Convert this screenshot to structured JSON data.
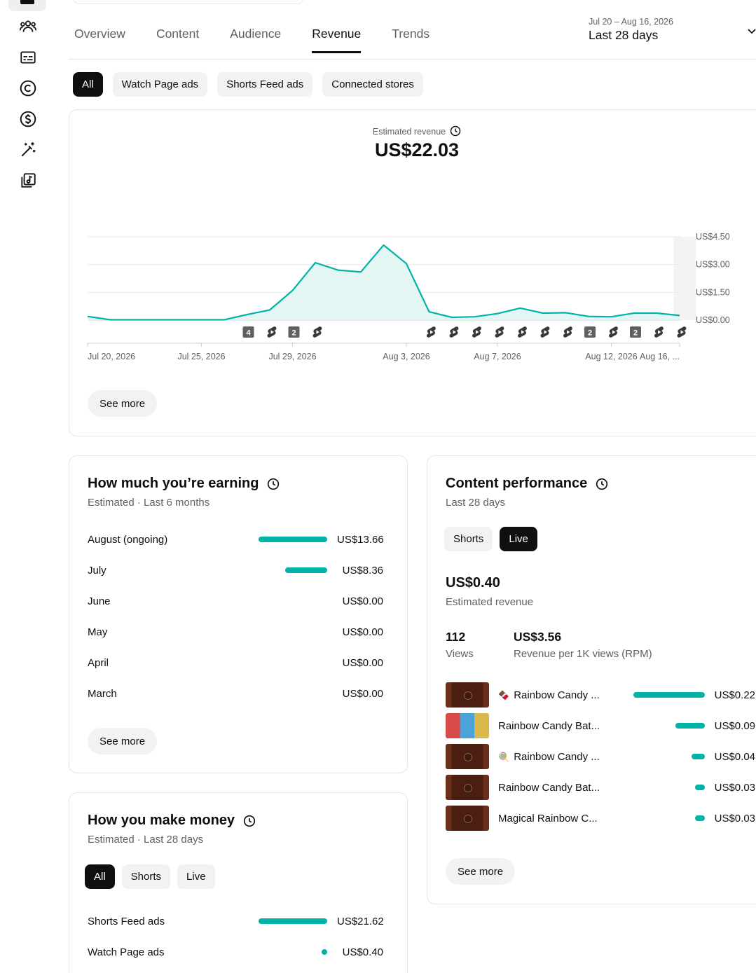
{
  "tabs": [
    "Overview",
    "Content",
    "Audience",
    "Revenue",
    "Trends"
  ],
  "active_tab": "Revenue",
  "date_range": {
    "dates": "Jul 20 – Aug 16, 2026",
    "label": "Last 28 days"
  },
  "chips": [
    "All",
    "Watch Page ads",
    "Shorts Feed ads",
    "Connected stores"
  ],
  "main": {
    "label": "Estimated revenue",
    "value": "US$22.03",
    "see_more": "See more"
  },
  "chart_data": {
    "type": "area",
    "ylim": [
      0,
      4.5
    ],
    "yticks": [
      "US$0.00",
      "US$1.50",
      "US$3.00",
      "US$4.50"
    ],
    "xtick_labels": [
      "Jul 20, 2026",
      "Jul 25, 2026",
      "Jul 29, 2026",
      "Aug 3, 2026",
      "Aug 7, 2026",
      "Aug 12, 2026",
      "Aug 16, ..."
    ],
    "xtick_index": [
      0,
      5,
      9,
      14,
      18,
      23,
      26
    ],
    "values": [
      0.2,
      0.02,
      0.02,
      0.02,
      0.02,
      0.02,
      0.02,
      0.3,
      0.55,
      1.6,
      3.1,
      2.7,
      2.6,
      4.05,
      3.05,
      0.45,
      0.15,
      0.18,
      0.35,
      0.65,
      0.38,
      0.4,
      0.2,
      0.18,
      0.38,
      0.38,
      0.25
    ],
    "markers": [
      {
        "day": 7,
        "kind": "badge",
        "text": "4"
      },
      {
        "day": 8,
        "kind": "shorts"
      },
      {
        "day": 9,
        "kind": "badge",
        "text": "2"
      },
      {
        "day": 10,
        "kind": "shorts"
      },
      {
        "day": 15,
        "kind": "shorts"
      },
      {
        "day": 16,
        "kind": "shorts"
      },
      {
        "day": 17,
        "kind": "shorts"
      },
      {
        "day": 18,
        "kind": "shorts"
      },
      {
        "day": 19,
        "kind": "shorts"
      },
      {
        "day": 20,
        "kind": "shorts"
      },
      {
        "day": 21,
        "kind": "shorts"
      },
      {
        "day": 22,
        "kind": "badge",
        "text": "2"
      },
      {
        "day": 23,
        "kind": "shorts"
      },
      {
        "day": 24,
        "kind": "badge",
        "text": "2"
      },
      {
        "day": 25,
        "kind": "shorts"
      },
      {
        "day": 26,
        "kind": "shorts"
      }
    ]
  },
  "earning": {
    "title": "How much you’re earning",
    "subtitle": "Estimated · Last 6 months",
    "see_more": "See more",
    "rows": [
      {
        "label": "August (ongoing)",
        "value": "US$13.66",
        "amount": 13.66
      },
      {
        "label": "July",
        "value": "US$8.36",
        "amount": 8.36
      },
      {
        "label": "June",
        "value": "US$0.00",
        "amount": 0
      },
      {
        "label": "May",
        "value": "US$0.00",
        "amount": 0
      },
      {
        "label": "April",
        "value": "US$0.00",
        "amount": 0
      },
      {
        "label": "March",
        "value": "US$0.00",
        "amount": 0
      }
    ]
  },
  "money": {
    "title": "How you make money",
    "subtitle": "Estimated · Last 28 days",
    "chips": [
      "All",
      "Shorts",
      "Live"
    ],
    "rows": [
      {
        "label": "Shorts Feed ads",
        "value": "US$21.62",
        "amount": 21.62
      },
      {
        "label": "Watch Page ads",
        "value": "US$0.40",
        "amount": 0.4
      }
    ]
  },
  "content": {
    "title": "Content performance",
    "subtitle": "Last 28 days",
    "chips": [
      "Shorts",
      "Live"
    ],
    "revenue_value": "US$0.40",
    "revenue_label": "Estimated revenue",
    "views_value": "112",
    "views_label": "Views",
    "rpm_value": "US$3.56",
    "rpm_label": "Revenue per 1K views (RPM)",
    "see_more": "See more",
    "videos": [
      {
        "title": "Rainbow Candy ...",
        "emoji": "🍫",
        "value": "US$0.22",
        "amount": 0.22,
        "thumb": "brown"
      },
      {
        "title": "Rainbow Candy Bat...",
        "emoji": "",
        "value": "US$0.09",
        "amount": 0.09,
        "thumb": "multi"
      },
      {
        "title": "Rainbow Candy ...",
        "emoji": "🍭",
        "value": "US$0.04",
        "amount": 0.04,
        "thumb": "brown"
      },
      {
        "title": "Rainbow Candy Bat...",
        "emoji": "",
        "value": "US$0.03",
        "amount": 0.03,
        "thumb": "brown"
      },
      {
        "title": "Magical Rainbow C...",
        "emoji": "",
        "value": "US$0.03",
        "amount": 0.03,
        "thumb": "brown"
      }
    ]
  },
  "colors": {
    "accent": "#00b3a6",
    "area_fill": "#e3f6f4",
    "text": "#0f0f0f",
    "muted": "#606060"
  }
}
